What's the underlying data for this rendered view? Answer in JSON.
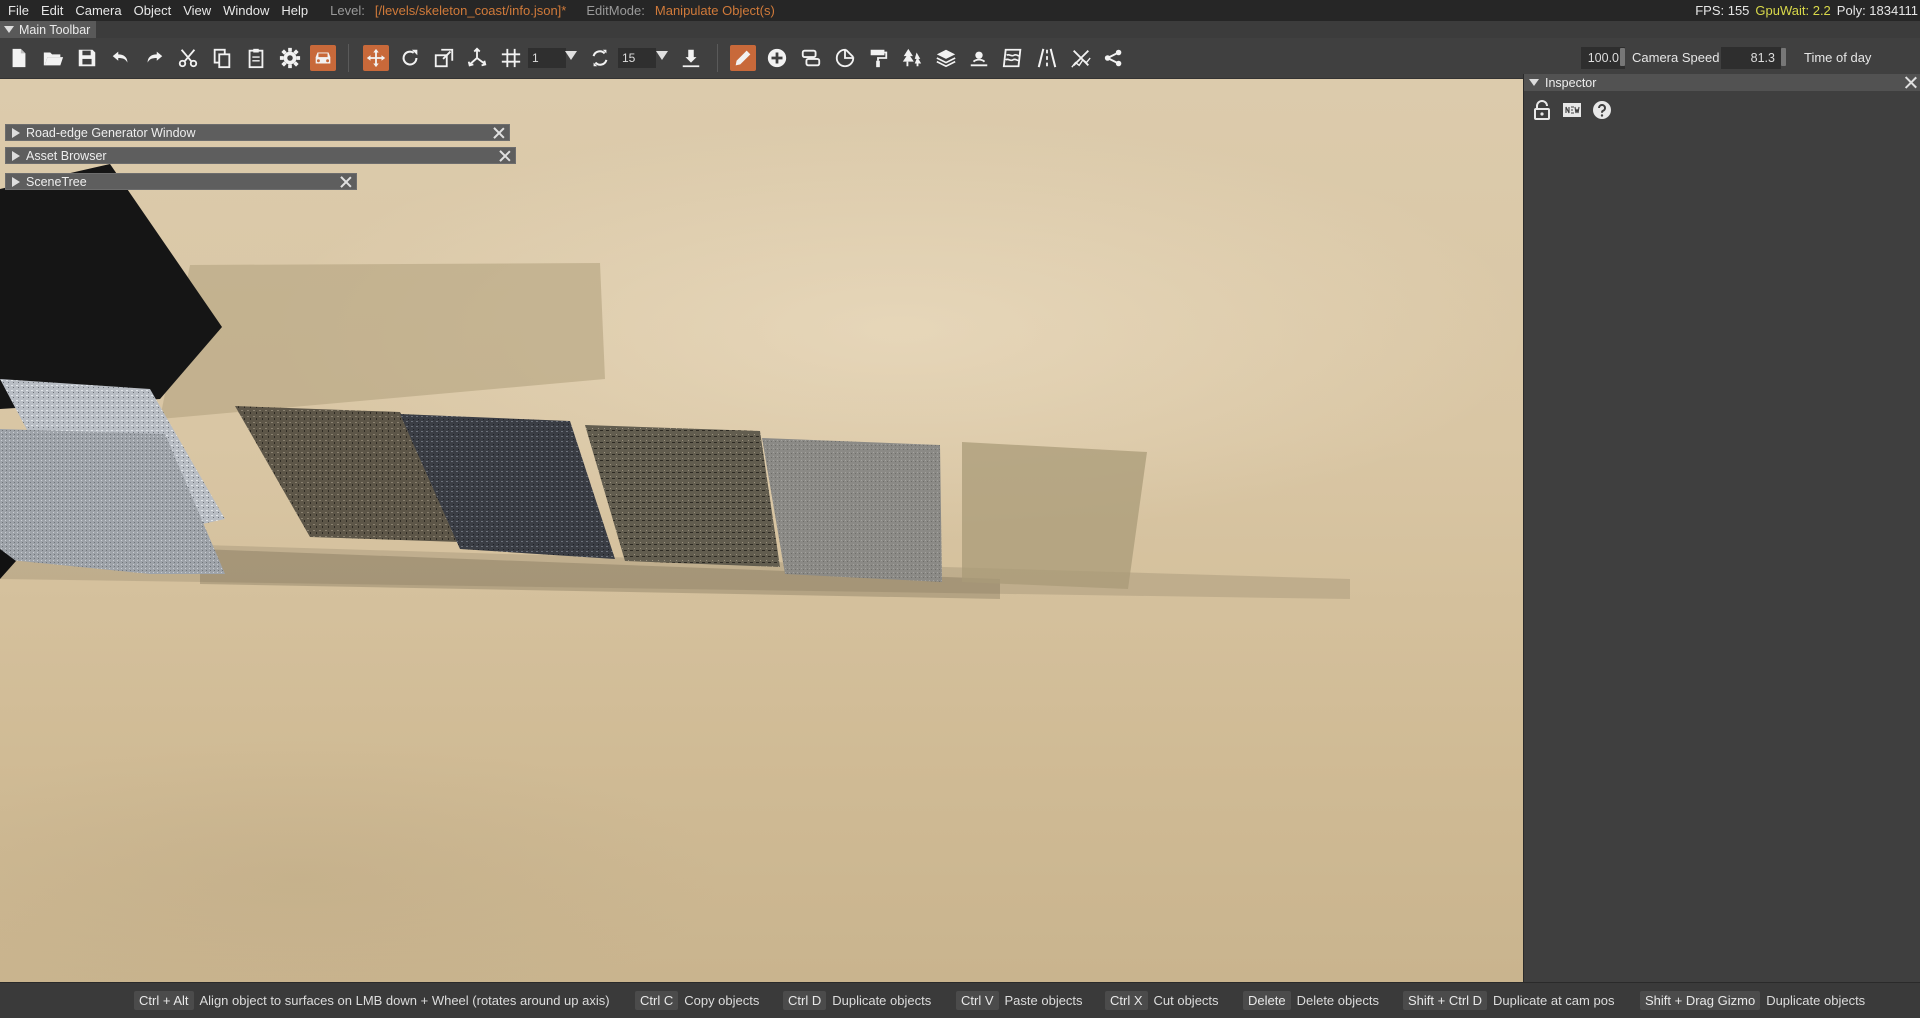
{
  "menu": {
    "items": [
      "File",
      "Edit",
      "Camera",
      "Object",
      "View",
      "Window",
      "Help"
    ],
    "level_label": "Level:",
    "level_value": "[/levels/skeleton_coast/info.json]*",
    "editmode_label": "EditMode:",
    "editmode_value": "Manipulate Object(s)",
    "fps": "FPS: 155",
    "gpuwait": "GpuWait: 2.2",
    "poly": "Poly: 1834111"
  },
  "toolbar": {
    "title": "Main Toolbar",
    "snap_value": "1",
    "rotate_snap_value": "15",
    "camera_speed_value": "100.0",
    "camera_speed_label": "Camera Speed",
    "time_of_day_value": "81.3",
    "time_of_day_label": "Time of day"
  },
  "panels": {
    "road_edge": "Road-edge Generator Window",
    "asset_browser": "Asset Browser",
    "scene_tree": "SceneTree"
  },
  "inspector": {
    "title": "Inspector"
  },
  "statusbar": {
    "hints": [
      {
        "key": "Ctrl + Alt",
        "desc": "Align object to surfaces on LMB down + Wheel (rotates around up axis)"
      },
      {
        "key": "Ctrl C",
        "desc": "Copy objects"
      },
      {
        "key": "Ctrl D",
        "desc": "Duplicate objects"
      },
      {
        "key": "Ctrl V",
        "desc": "Paste objects"
      },
      {
        "key": "Ctrl X",
        "desc": "Cut objects"
      },
      {
        "key": "Delete",
        "desc": "Delete objects"
      },
      {
        "key": "Shift + Ctrl D",
        "desc": "Duplicate at cam pos"
      },
      {
        "key": "Shift + Drag Gizmo",
        "desc": "Duplicate objects"
      }
    ]
  },
  "colors": {
    "accent": "#c8693a",
    "level_text": "#d07a3a",
    "gpuwait_text": "#d8d84a"
  }
}
